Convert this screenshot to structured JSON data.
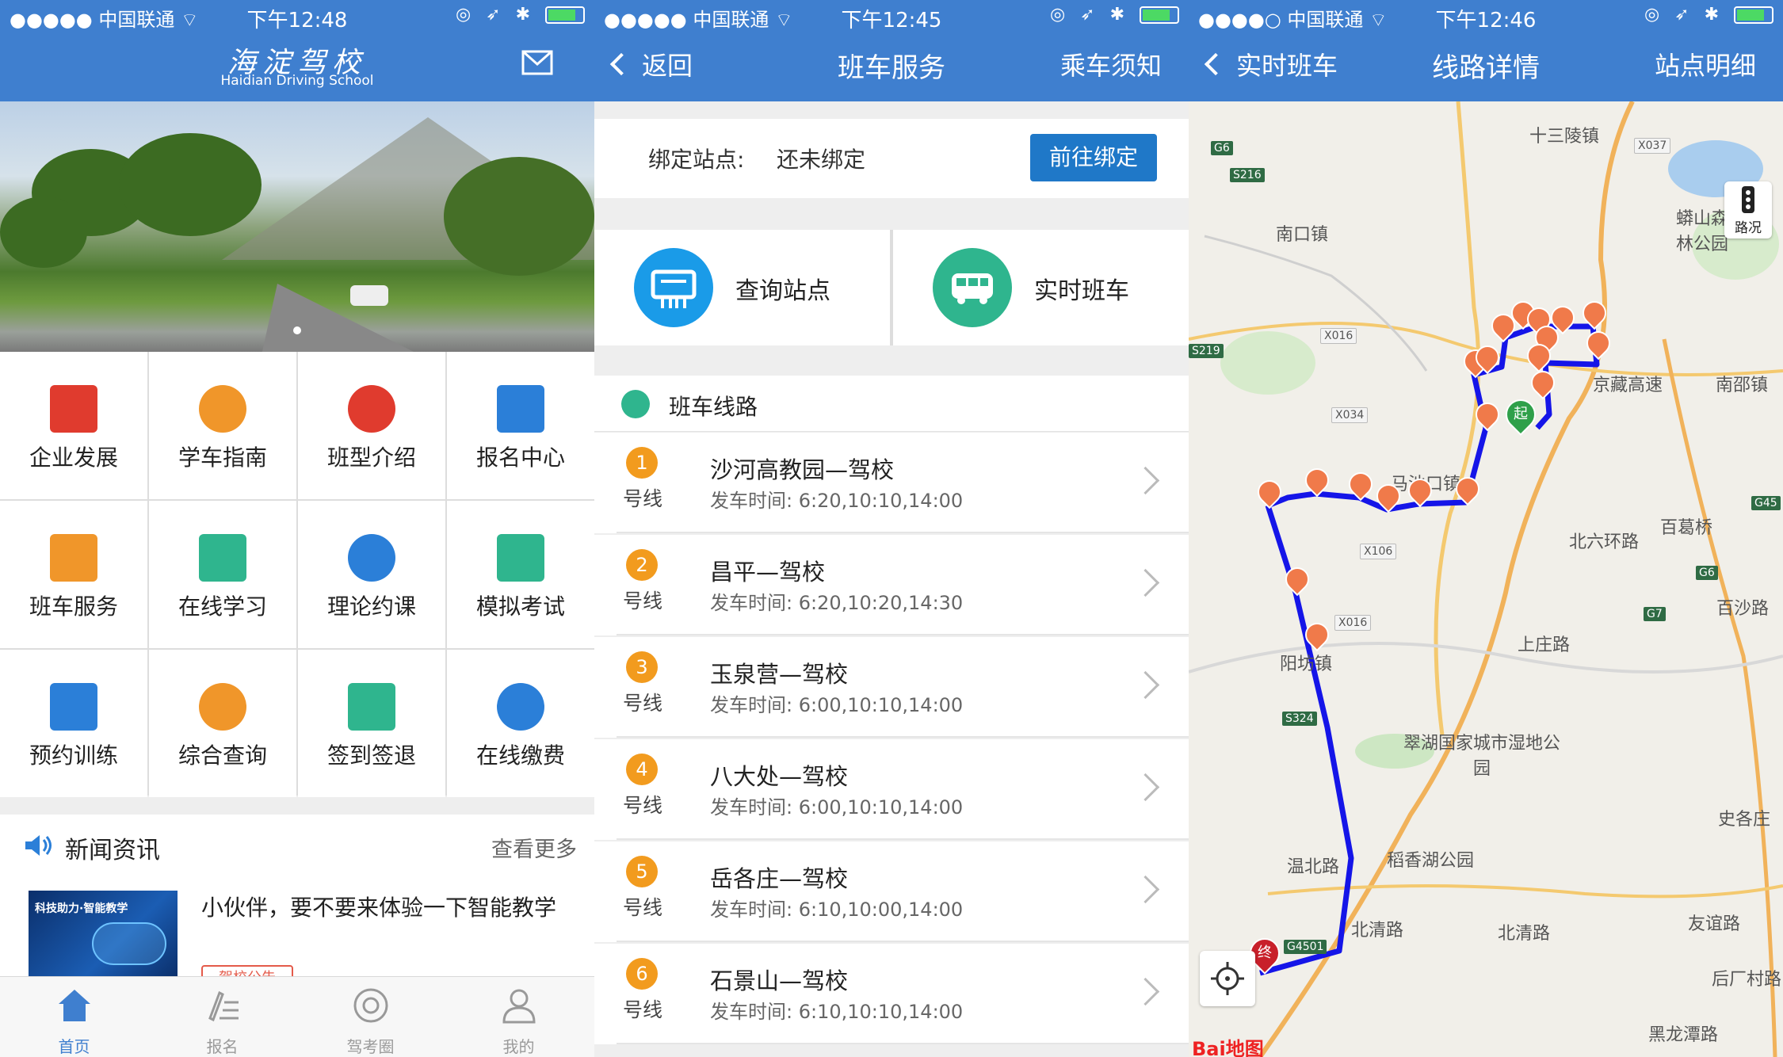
{
  "status": [
    {
      "carrier": "●●●●● 中国联通 ⌔",
      "time": "下午12:48"
    },
    {
      "carrier": "●●●●● 中国联通 ⌔",
      "time": "下午12:45"
    },
    {
      "carrier": "●●●●○ 中国联通 ⌔",
      "time": "下午12:46"
    }
  ],
  "home": {
    "logo_cn": "海淀驾校",
    "logo_en": "Haidian Driving School",
    "menu": [
      {
        "label": "企业发展",
        "icon": "building-icon",
        "color": "#e03b2e"
      },
      {
        "label": "学车指南",
        "icon": "compass-icon",
        "color": "#f0962a"
      },
      {
        "label": "班型介绍",
        "icon": "steering-wheel-icon",
        "color": "#e03b2e"
      },
      {
        "label": "报名中心",
        "icon": "signup-pen-icon",
        "color": "#2b7fd8"
      },
      {
        "label": "班车服务",
        "icon": "bus-icon",
        "color": "#f0962a"
      },
      {
        "label": "在线学习",
        "icon": "monitor-icon",
        "color": "#2fb58e"
      },
      {
        "label": "理论约课",
        "icon": "clock-icon",
        "color": "#2b7fd8"
      },
      {
        "label": "模拟考试",
        "icon": "document-icon",
        "color": "#2fb58e"
      },
      {
        "label": "预约训练",
        "icon": "car-icon",
        "color": "#2b7fd8"
      },
      {
        "label": "综合查询",
        "icon": "search-icon",
        "color": "#f0962a"
      },
      {
        "label": "签到签退",
        "icon": "calendar-check-icon",
        "color": "#2fb58e"
      },
      {
        "label": "在线缴费",
        "icon": "yuan-icon",
        "color": "#2b7fd8"
      }
    ],
    "news": {
      "title": "新闻资讯",
      "more": "查看更多",
      "item_text": "小伙伴，要不要来体验一下智能教学",
      "tag": "驾校公告",
      "thumb_caption": "科技助力·智能教学"
    },
    "tabs": [
      {
        "label": "首页",
        "icon": "home-icon",
        "active": true
      },
      {
        "label": "报名",
        "icon": "signup-icon",
        "active": false
      },
      {
        "label": "驾考圈",
        "icon": "circle-icon",
        "active": false
      },
      {
        "label": "我的",
        "icon": "user-icon",
        "active": false
      }
    ]
  },
  "shuttle": {
    "back": "返回",
    "title": "班车服务",
    "right": "乘车须知",
    "bind_label": "绑定站点:",
    "bind_value": "还未绑定",
    "bind_button": "前往绑定",
    "quick": [
      {
        "label": "查询站点",
        "icon": "station-board-icon",
        "color": "#1a9be8"
      },
      {
        "label": "实时班车",
        "icon": "bus-icon",
        "color": "#2fb58e"
      }
    ],
    "section_title": "班车线路",
    "route_suffix": "号线",
    "routes": [
      {
        "num": "1",
        "name": "沙河高教园—驾校",
        "time": "发车时间:  6:20,10:10,14:00"
      },
      {
        "num": "2",
        "name": "昌平—驾校",
        "time": "发车时间:  6:20,10:20,14:30"
      },
      {
        "num": "3",
        "name": "玉泉营—驾校",
        "time": "发车时间:  6:00,10:10,14:00"
      },
      {
        "num": "4",
        "name": "八大处—驾校",
        "time": "发车时间:  6:00,10:10,14:00"
      },
      {
        "num": "5",
        "name": "岳各庄—驾校",
        "time": "发车时间:  6:10,10:00,14:00"
      },
      {
        "num": "6",
        "name": "石景山—驾校",
        "time": "发车时间:  6:10,10:10,14:00"
      }
    ]
  },
  "map": {
    "back": "实时班车",
    "title": "线路详情",
    "right": "站点明细",
    "traffic": "路况",
    "start": "起",
    "end": "终",
    "brand": "Bai地图",
    "labels": [
      "十三陵镇",
      "南口镇",
      "马池口镇",
      "百葛桥",
      "南邵镇",
      "翠湖国家城市湿地公园",
      "稻香湖公园",
      "北清路",
      "北清路",
      "阳坊镇",
      "温北路",
      "史各庄",
      "百沙路",
      "后厂村路",
      "蟒山森林公园",
      "京藏高速",
      "黑龙潭路",
      "友谊路",
      "上庄路",
      "北六环路"
    ],
    "shields": [
      "G6",
      "S216",
      "X016",
      "X034",
      "G7",
      "X037",
      "S219",
      "X106",
      "X016",
      "S324",
      "G6",
      "G7",
      "G4501",
      "G45"
    ]
  }
}
